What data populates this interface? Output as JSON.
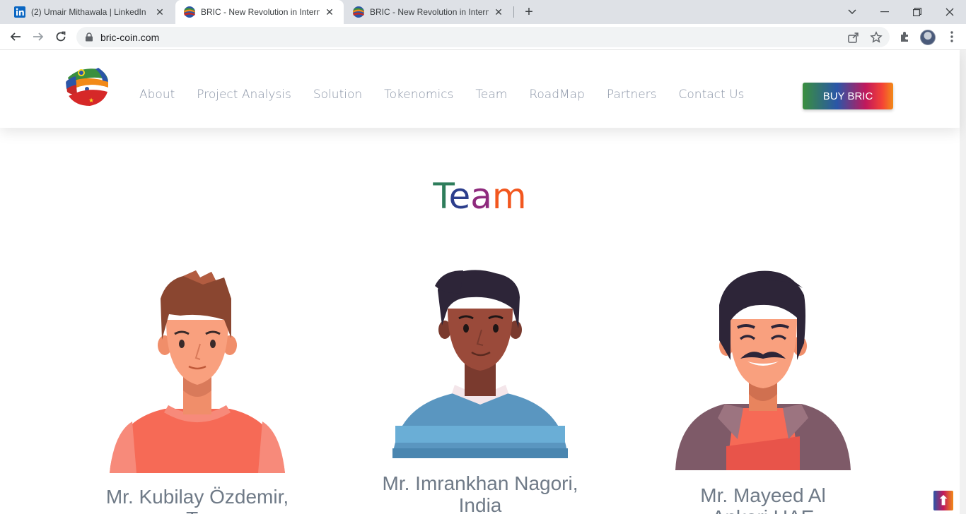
{
  "browser": {
    "tabs": [
      {
        "title": "(2) Umair Mithawala | LinkedIn",
        "favicon": "linkedin-icon",
        "active": false
      },
      {
        "title": "BRIC - New Revolution in Interna",
        "favicon": "bric-logo-icon",
        "active": true
      },
      {
        "title": "BRIC - New Revolution in Interna",
        "favicon": "bric-logo-icon",
        "active": false
      }
    ],
    "url": "bric-coin.com"
  },
  "site": {
    "nav": [
      "About",
      "Project Analysis",
      "Solution",
      "Tokenomics",
      "Team",
      "RoadMap",
      "Partners",
      "Contact Us"
    ],
    "buy_label": "BUY BRIC",
    "heading_letters": [
      "T",
      "e",
      "a",
      "m"
    ],
    "members": [
      {
        "name_line1": "Mr. Kubilay Özdemir,",
        "name_line2": "Tu"
      },
      {
        "name_line1": "Mr. Imrankhan Nagori,",
        "name_line2": "India"
      },
      {
        "name_line1": "Mr. Mayeed Al",
        "name_line2": "Ankari UAE"
      }
    ],
    "scroll_top_icon": "arrow-up-icon"
  },
  "colors": {
    "nav_text": "#8a94a6",
    "heading_green": "#2e7d5b",
    "heading_blue": "#2c3e8c",
    "heading_purple": "#8e2a7d",
    "heading_orange": "#f2571f"
  }
}
